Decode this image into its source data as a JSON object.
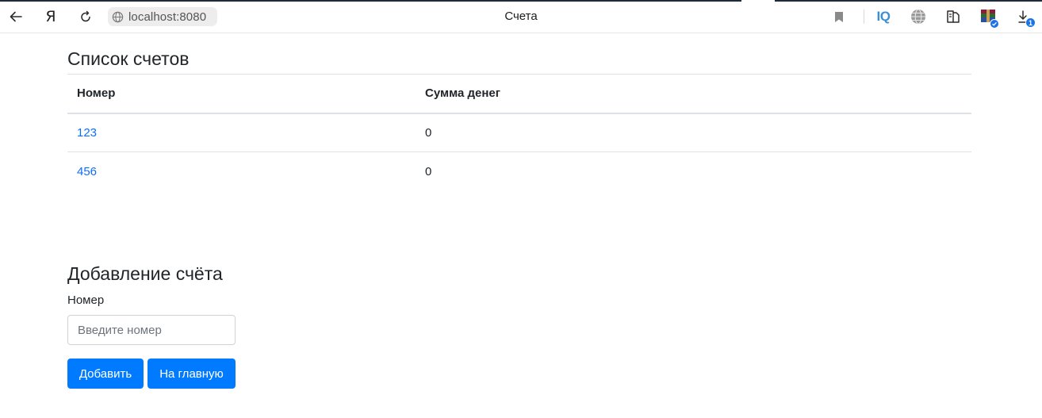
{
  "browser": {
    "address": "localhost:8080",
    "tab_title": "Счета",
    "yandex_logo": "Я",
    "iq_label": "IQ",
    "downloads_count": "1",
    "icons": [
      "back-arrow-icon",
      "yandex-logo-icon",
      "reload-icon",
      "site-globe-icon",
      "bookmark-icon",
      "iq-icon",
      "globe-icon",
      "reader-icon",
      "winrar-extension-icon",
      "download-icon"
    ]
  },
  "accounts": {
    "title": "Список счетов",
    "columns": [
      "Номер",
      "Сумма денег"
    ],
    "rows": [
      {
        "number": "123",
        "amount": "0"
      },
      {
        "number": "456",
        "amount": "0"
      }
    ]
  },
  "add_form": {
    "title": "Добавление счёта",
    "number_label": "Номер",
    "number_placeholder": "Введите номер",
    "number_value": "",
    "add_button": "Добавить",
    "home_button": "На главную"
  },
  "colors": {
    "primary_button": "#007bff",
    "link": "#0d6efd"
  }
}
